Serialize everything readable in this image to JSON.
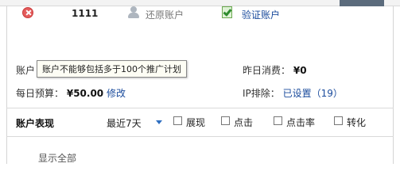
{
  "toolbar": {
    "close_icon": "close-icon",
    "account_id": "1111",
    "restore_label": "还原账户",
    "verify_label": "验证账户"
  },
  "tooltip": {
    "text": "账户不能够包括多于100个推广计划",
    "anchor_label_partial": "账户"
  },
  "summary": {
    "yesterday_label": "昨日消费：",
    "yesterday_value": "¥0",
    "budget_label": "每日预算：",
    "budget_value": "¥50.00",
    "budget_edit": "修改",
    "ip_label": "IP排除：",
    "ip_value": "已设置（19）"
  },
  "performance": {
    "title": "账户表现",
    "period": "最近7天",
    "metrics": [
      {
        "label": "展现",
        "checked": false
      },
      {
        "label": "点击",
        "checked": false
      },
      {
        "label": "点击率",
        "checked": false
      },
      {
        "label": "转化",
        "checked": false
      }
    ],
    "show_all": "显示全部"
  },
  "colors": {
    "link": "#1a4b9c",
    "caret": "#2f6fc1",
    "close": "#e45b5b",
    "verify": "#2e8b2e"
  }
}
